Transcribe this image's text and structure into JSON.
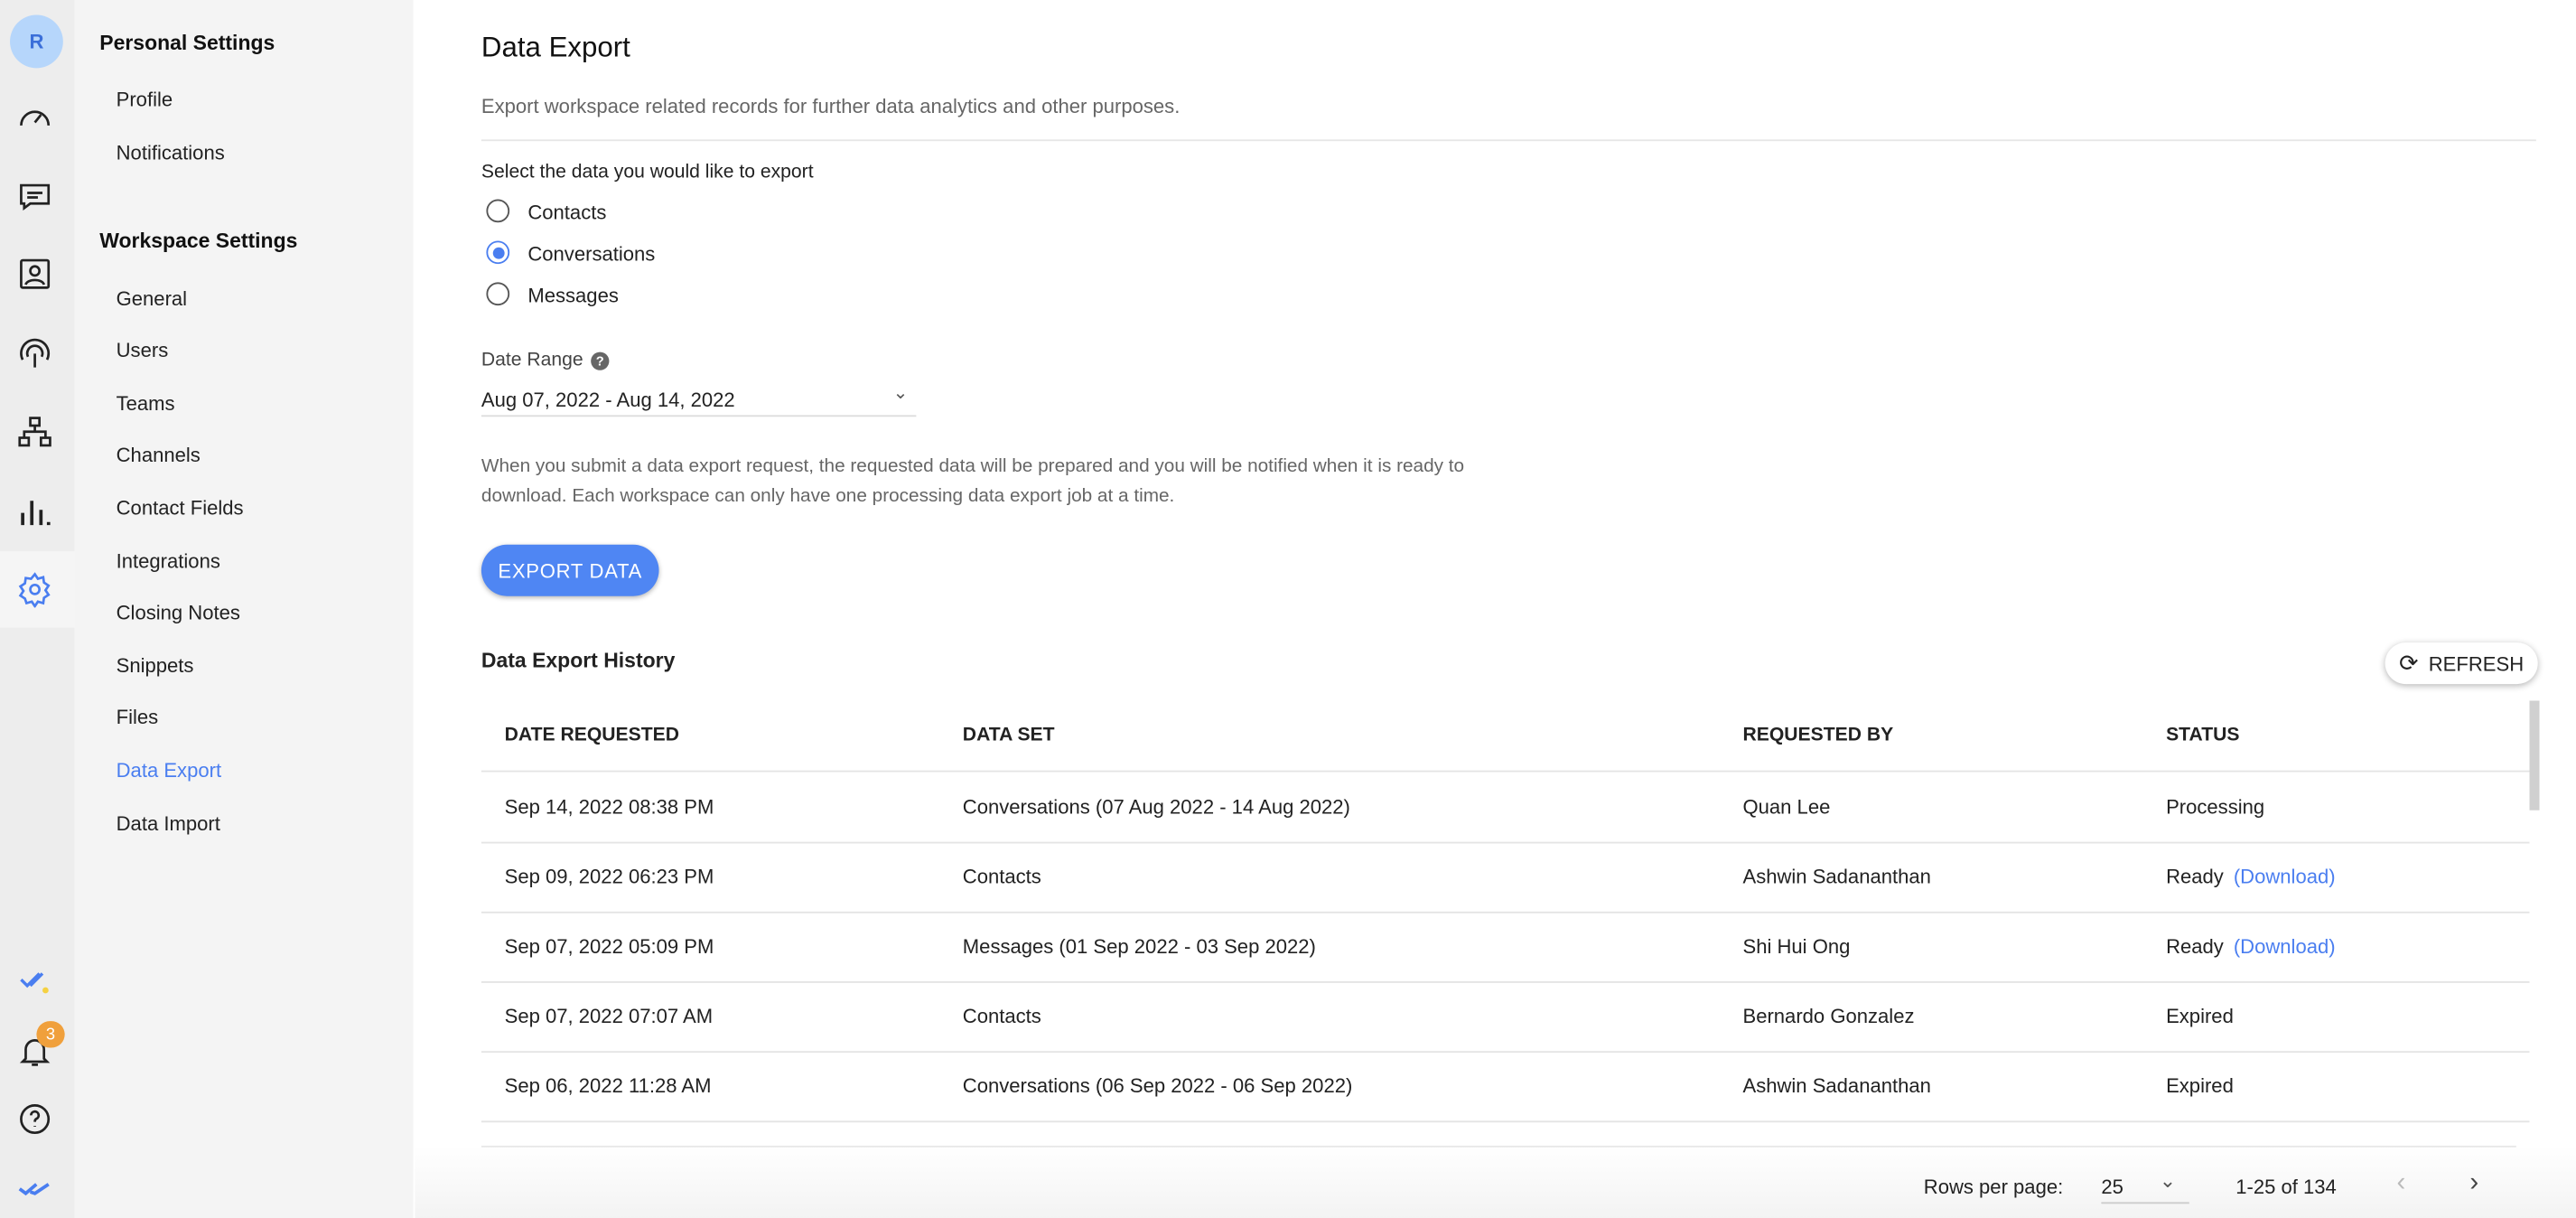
{
  "rail": {
    "avatar": "R",
    "badge": "3",
    "icons": [
      "dashboard-icon",
      "conversations-icon",
      "contacts-icon",
      "broadcast-icon",
      "workflow-icon",
      "reports-icon",
      "settings-icon",
      "status-icon",
      "bell-icon",
      "help-icon",
      "logo-icon"
    ]
  },
  "sidebar": {
    "personal_title": "Personal Settings",
    "personal": [
      "Profile",
      "Notifications"
    ],
    "workspace_title": "Workspace Settings",
    "workspace": [
      "General",
      "Users",
      "Teams",
      "Channels",
      "Contact Fields",
      "Integrations",
      "Closing Notes",
      "Snippets",
      "Files",
      "Data Export",
      "Data Import"
    ]
  },
  "main": {
    "title": "Data Export",
    "subtitle": "Export workspace related records for further data analytics and other purposes.",
    "select_label": "Select the data you would like to export",
    "options": [
      "Contacts",
      "Conversations",
      "Messages"
    ],
    "selected": "Conversations",
    "date_label": "Date Range",
    "date_value": "Aug 07, 2022 - Aug 14, 2022",
    "note": "When you submit a data export request, the requested data will be prepared and you will be notified when it is ready to download. Each workspace can only have one processing data export job at a time.",
    "export_button": "EXPORT DATA",
    "history_title": "Data Export History",
    "refresh": "REFRESH"
  },
  "table": {
    "headers": [
      "DATE REQUESTED",
      "DATA SET",
      "REQUESTED BY",
      "STATUS"
    ],
    "download": "(Download)",
    "rows": [
      {
        "date": "Sep 14, 2022 08:38 PM",
        "set": "Conversations (07 Aug 2022 - 14 Aug 2022)",
        "by": "Quan Lee",
        "status": "Processing"
      },
      {
        "date": "Sep 09, 2022 06:23 PM",
        "set": "Contacts",
        "by": "Ashwin Sadananthan",
        "status": "Ready"
      },
      {
        "date": "Sep 07, 2022 05:09 PM",
        "set": "Messages (01 Sep 2022 - 03 Sep 2022)",
        "by": "Shi Hui Ong",
        "status": "Ready"
      },
      {
        "date": "Sep 07, 2022 07:07 AM",
        "set": "Contacts",
        "by": "Bernardo Gonzalez",
        "status": "Expired"
      },
      {
        "date": "Sep 06, 2022 11:28 AM",
        "set": "Conversations (06 Sep 2022 - 06 Sep 2022)",
        "by": "Ashwin Sadananthan",
        "status": "Expired"
      }
    ]
  },
  "pagination": {
    "rows_label": "Rows per page:",
    "rows_value": "25",
    "range": "1-25 of 134"
  },
  "colors": {
    "accent": "#4a7ef0",
    "badge": "#f0a03c"
  }
}
